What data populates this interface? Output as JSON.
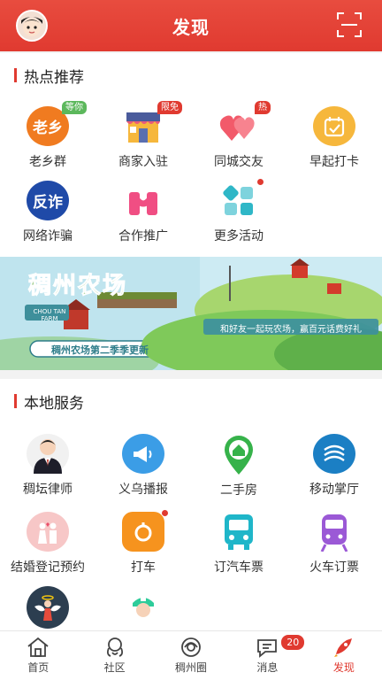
{
  "header": {
    "title": "发现"
  },
  "hot": {
    "title": "热点推荐",
    "items": [
      {
        "label": "老乡群",
        "icon": "laoxiang-icon",
        "icon_text": "老乡",
        "badge": "等你",
        "badge_color": "#5cb85c"
      },
      {
        "label": "商家入驻",
        "icon": "shop-icon",
        "badge": "限免",
        "badge_color": "#e03a30"
      },
      {
        "label": "同城交友",
        "icon": "hearts-icon",
        "badge": "热",
        "badge_color": "#e03a30"
      },
      {
        "label": "早起打卡",
        "icon": "calendar-check-icon"
      },
      {
        "label": "网络诈骗",
        "icon": "fraud-icon",
        "icon_text": "反诈"
      },
      {
        "label": "合作推广",
        "icon": "partner-icon"
      },
      {
        "label": "更多活动",
        "icon": "more-activities-icon",
        "dot": true
      }
    ]
  },
  "banner": {
    "title": "稠州农场",
    "english": "CHOU TAN FARM",
    "subtitle": "稠州农场第二季季更新",
    "slogan": "和好友一起玩农场，赢百元话费好礼"
  },
  "local": {
    "title": "本地服务",
    "items": [
      {
        "label": "稠坛律师",
        "icon": "lawyer-icon"
      },
      {
        "label": "义乌播报",
        "icon": "megaphone-icon"
      },
      {
        "label": "二手房",
        "icon": "house-pin-icon"
      },
      {
        "label": "移动掌厅",
        "icon": "china-mobile-icon"
      },
      {
        "label": "结婚登记预约",
        "icon": "wedding-icon"
      },
      {
        "label": "打车",
        "icon": "taxi-icon",
        "dot": true
      },
      {
        "label": "订汽车票",
        "icon": "bus-icon"
      },
      {
        "label": "火车订票",
        "icon": "train-icon"
      },
      {
        "label": "",
        "icon": "angel-icon"
      },
      {
        "label": "",
        "icon": "nurse-icon"
      }
    ]
  },
  "tabbar": {
    "items": [
      {
        "label": "首页",
        "icon": "home-icon"
      },
      {
        "label": "社区",
        "icon": "community-icon"
      },
      {
        "label": "稠州圈",
        "icon": "circle-icon"
      },
      {
        "label": "消息",
        "icon": "message-icon",
        "badge": "20"
      },
      {
        "label": "发现",
        "icon": "discover-icon",
        "active": true
      }
    ]
  }
}
